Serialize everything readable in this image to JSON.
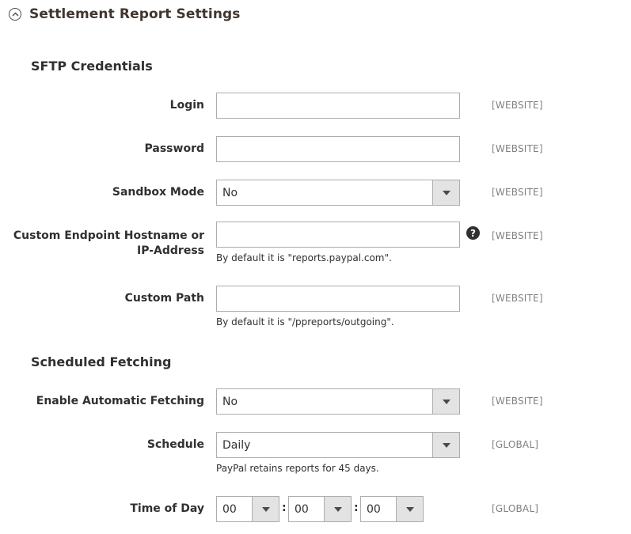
{
  "section": {
    "title": "Settlement Report Settings"
  },
  "sftp": {
    "title": "SFTP Credentials",
    "login": {
      "label": "Login",
      "value": "",
      "scope": "[WEBSITE]"
    },
    "password": {
      "label": "Password",
      "value": "",
      "scope": "[WEBSITE]"
    },
    "sandbox": {
      "label": "Sandbox Mode",
      "value": "No",
      "scope": "[WEBSITE]"
    },
    "hostname": {
      "label": "Custom Endpoint Hostname or IP-Address",
      "value": "",
      "note": "By default it is \"reports.paypal.com\".",
      "scope": "[WEBSITE]",
      "help": "?"
    },
    "path": {
      "label": "Custom Path",
      "value": "",
      "note": "By default it is \"/ppreports/outgoing\".",
      "scope": "[WEBSITE]"
    }
  },
  "fetching": {
    "title": "Scheduled Fetching",
    "enable": {
      "label": "Enable Automatic Fetching",
      "value": "No",
      "scope": "[WEBSITE]"
    },
    "schedule": {
      "label": "Schedule",
      "value": "Daily",
      "note": "PayPal retains reports for 45 days.",
      "scope": "[GLOBAL]"
    },
    "time": {
      "label": "Time of Day",
      "hour": "00",
      "minute": "00",
      "second": "00",
      "separator": ":",
      "scope": "[GLOBAL]"
    }
  }
}
